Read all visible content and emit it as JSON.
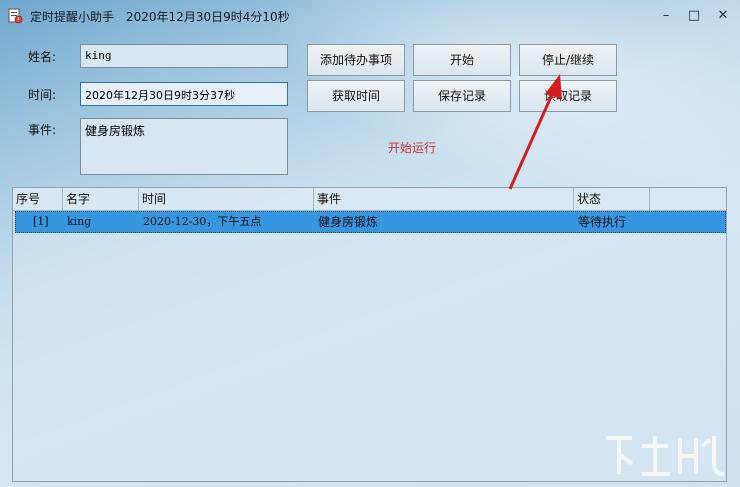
{
  "window": {
    "app_name": "定时提醒小助手",
    "clock": "2020年12月30日9时4分10秒",
    "controls": {
      "minimize": "–",
      "maximize": "□",
      "close": "✕"
    }
  },
  "form": {
    "name_label": "姓名:",
    "name_value": "king",
    "time_label": "时间:",
    "time_value": "2020年12月30日9时3分37秒",
    "event_label": "事件:",
    "event_value": "健身房锻炼"
  },
  "buttons": {
    "add_todo": "添加待办事项",
    "start": "开始",
    "stop_continue": "停止/继续",
    "get_time": "获取时间",
    "save_record": "保存记录",
    "read_record": "读取记录"
  },
  "status_text": "开始运行",
  "colors": {
    "status": "#d0342c",
    "selection": "#3796e0",
    "arrow": "#d21e1e"
  },
  "table": {
    "columns": [
      "序号",
      "名字",
      "时间",
      "事件",
      "状态"
    ],
    "rows": [
      {
        "index": "[1]",
        "name": "king",
        "time": "2020-12-30，下午五点",
        "event": "健身房锻炼",
        "status": "等待执行"
      }
    ]
  }
}
